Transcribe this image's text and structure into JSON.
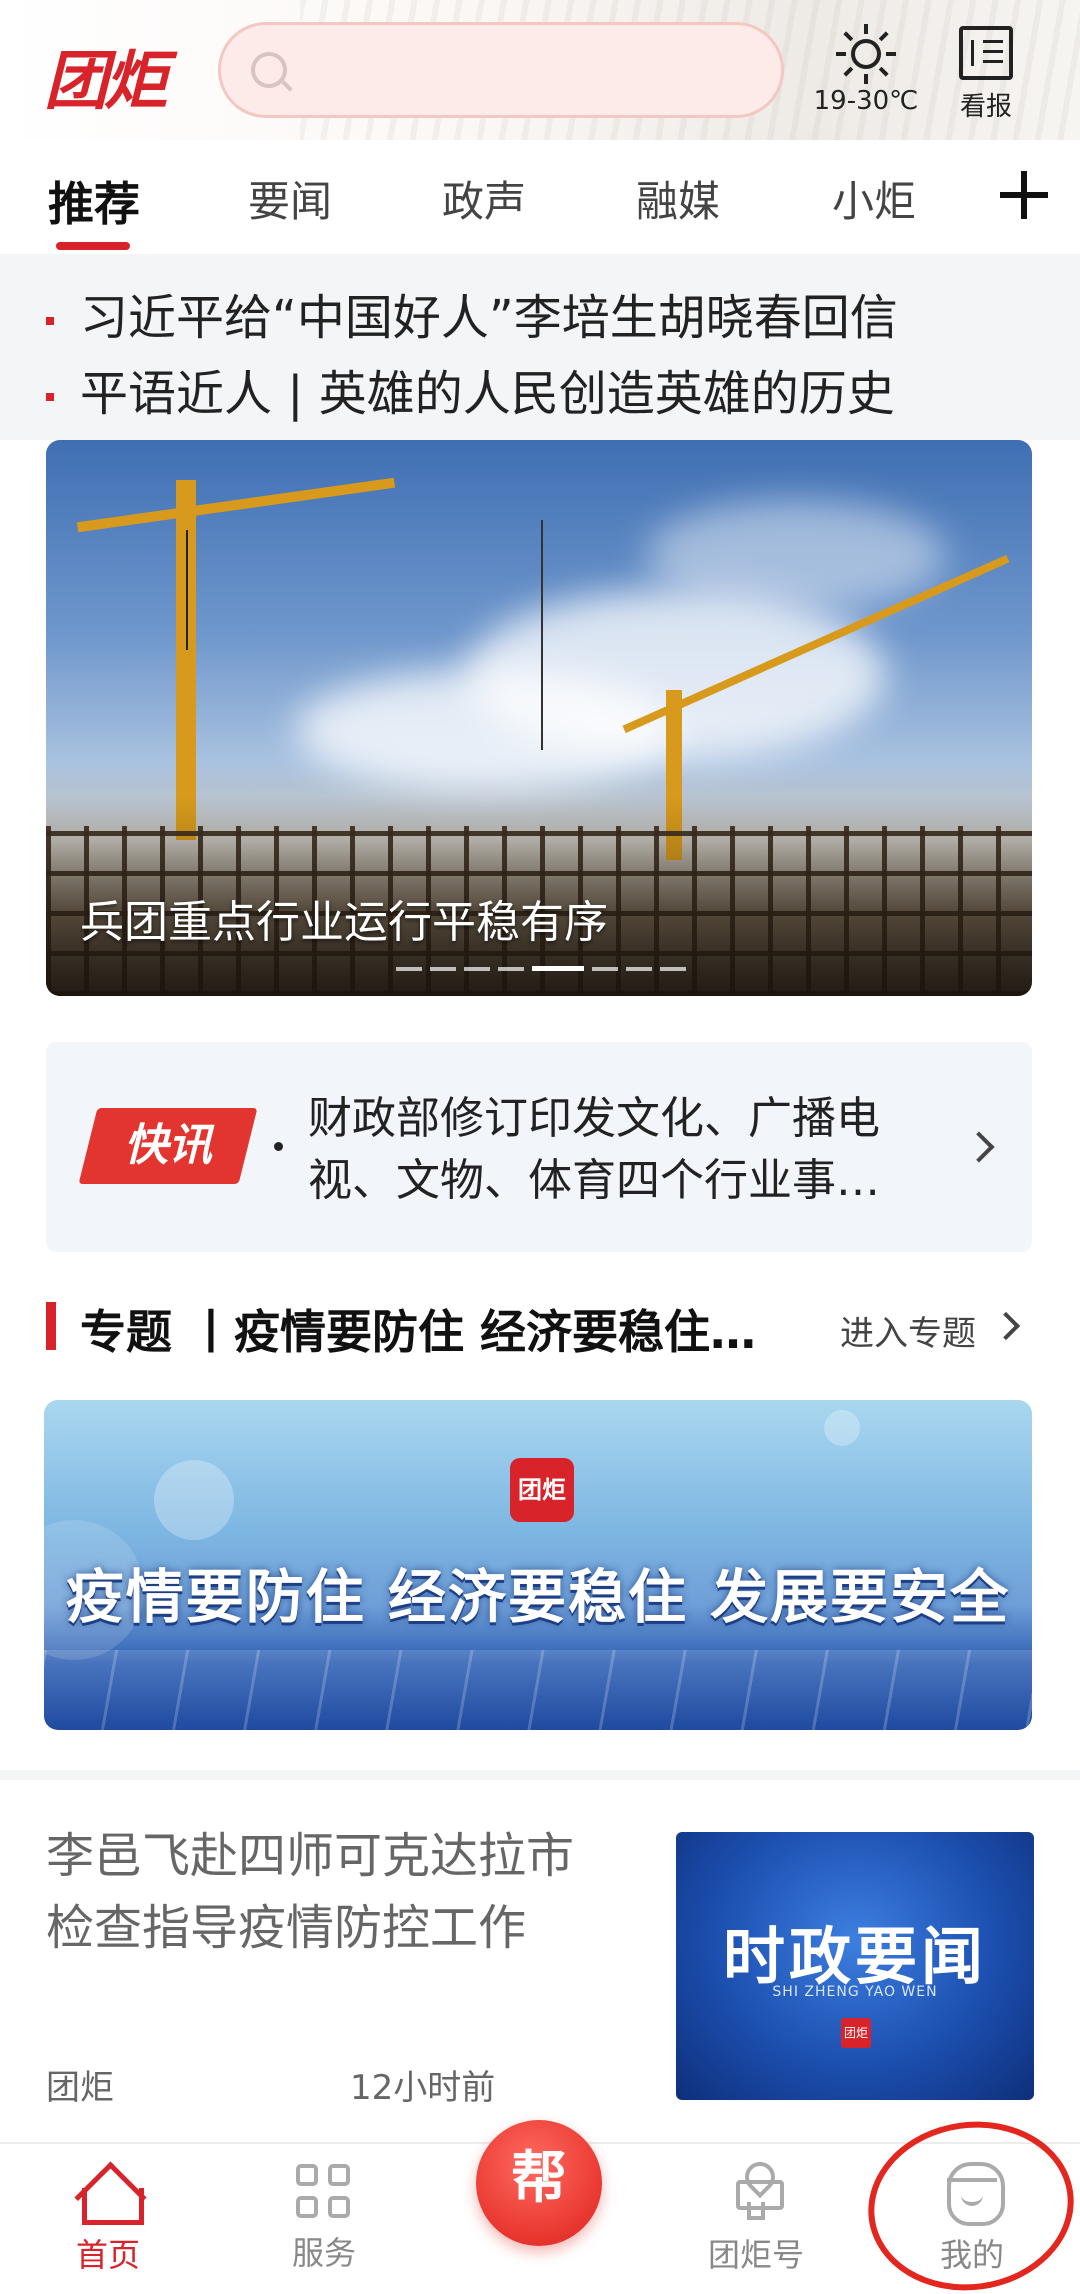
{
  "header": {
    "logo_text": "团炬",
    "search_placeholder": "",
    "weather_temp": "19-30℃",
    "newspaper_label": "看报"
  },
  "tabs": [
    {
      "label": "推荐",
      "active": true
    },
    {
      "label": "要闻",
      "active": false
    },
    {
      "label": "政声",
      "active": false
    },
    {
      "label": "融媒",
      "active": false
    },
    {
      "label": "小炬",
      "active": false
    }
  ],
  "headlines": [
    "习近平给“中国好人”李培生胡晓春回信",
    "平语近人 | 英雄的人民创造英雄的历史"
  ],
  "banner": {
    "caption": "兵团重点行业运行平稳有序",
    "slide_count": 8,
    "active_slide": 5
  },
  "flash": {
    "badge": "快讯",
    "line1": "财政部修订印发文化、广播电",
    "line2": "视、文物、体育四个行业事…"
  },
  "topic": {
    "title": "专题 丨疫情要防住 经济要稳住…",
    "enter_label": "进入专题",
    "banner_logo": "团炬",
    "banner_text": "疫情要防住  经济要稳住  发展要安全"
  },
  "article": {
    "title_line1": "李邑飞赴四师可克达拉市",
    "title_line2": "检查指导疫情防控工作",
    "source": "团炬",
    "time": "12小时前",
    "thumb_title": "时政要闻",
    "thumb_sub": "SHI ZHENG YAO WEN",
    "thumb_logo": "团炬"
  },
  "bottom_nav": {
    "home": "首页",
    "service": "服务",
    "help": "帮",
    "account": "团炬号",
    "mine": "我的"
  },
  "colors": {
    "brand_red": "#d8232a",
    "annotation_red": "#e3271f"
  }
}
